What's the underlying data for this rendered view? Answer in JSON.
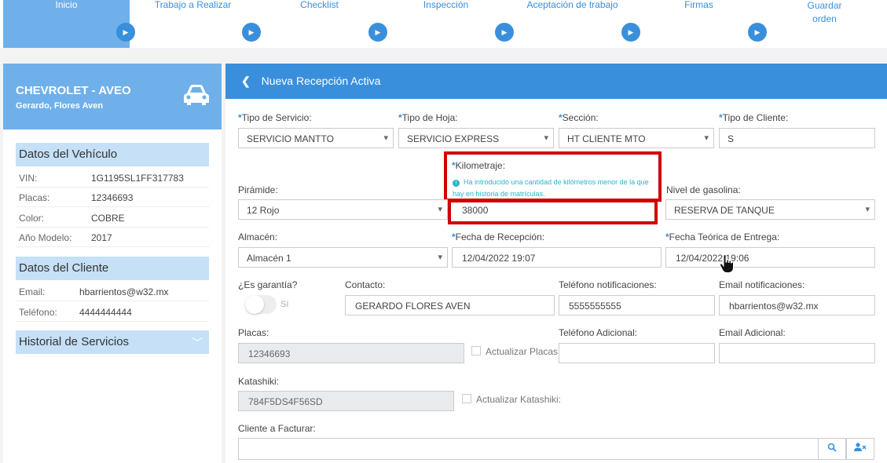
{
  "stepper": {
    "steps": [
      {
        "label": "Inicio"
      },
      {
        "label": "Trabajo a Realizar"
      },
      {
        "label": "Checklist"
      },
      {
        "label": "Inspección"
      },
      {
        "label": "Aceptación de trabajo"
      },
      {
        "label": "Firmas"
      },
      {
        "label": "Guardar\norden"
      }
    ]
  },
  "vehicle": {
    "title": "CHEVROLET - AVEO",
    "owner": "Gerardo, Flores Aven",
    "section_title": "Datos del Vehículo",
    "fields": [
      {
        "label": "VIN:",
        "value": "1G1195SL1FF317783"
      },
      {
        "label": "Placas:",
        "value": "12346693"
      },
      {
        "label": "Color:",
        "value": "COBRE"
      },
      {
        "label": "Año Modelo:",
        "value": "2017"
      }
    ]
  },
  "client": {
    "section_title": "Datos del Cliente",
    "fields": [
      {
        "label": "Email:",
        "value": "hbarrientos@w32.mx"
      },
      {
        "label": "Teléfono:",
        "value": "4444444444"
      }
    ]
  },
  "history": {
    "title": "Historial de Servicios"
  },
  "form": {
    "header": "Nueva Recepción Activa",
    "tipo_servicio": {
      "label": "Tipo de Servicio:",
      "value": "SERVICIO MANTTO"
    },
    "tipo_hoja": {
      "label": "Tipo de Hoja:",
      "value": "SERVICIO EXPRESS"
    },
    "seccion": {
      "label": "Sección:",
      "value": "HT CLIENTE MTO"
    },
    "tipo_cliente": {
      "label": "Tipo de Cliente:",
      "value": "S"
    },
    "kilometraje": {
      "label": "Kilometraje:",
      "value": "38000",
      "warning": "Ha introducido una cantidad de kilómetros menor de la que hay en historia de matrículas."
    },
    "piramide": {
      "label": "Pirámide:",
      "value": "12 Rojo"
    },
    "gasolina": {
      "label": "Nivel de gasolina:",
      "value": "RESERVA DE TANQUE"
    },
    "almacen": {
      "label": "Almacén:",
      "value": "Almacén 1"
    },
    "fecha_recepcion": {
      "label": "Fecha de Recepción:",
      "value": "12/04/2022 19:07"
    },
    "fecha_entrega": {
      "label": "Fecha Teórica de Entrega:",
      "value": "12/04/2022 19:06"
    },
    "garantia": {
      "label": "¿Es garantía?",
      "toggle_label": "Sí"
    },
    "contacto": {
      "label": "Contacto:",
      "value": "GERARDO FLORES AVEN"
    },
    "tel_notif": {
      "label": "Teléfono notificaciones:",
      "value": "5555555555"
    },
    "email_notif": {
      "label": "Email notificaciones:",
      "value": "hbarrientos@w32.mx"
    },
    "placas": {
      "label": "Placas:",
      "value": "12346693",
      "update_label": "Actualizar Placas:"
    },
    "tel_adicional": {
      "label": "Teléfono Adicional:",
      "value": ""
    },
    "email_adicional": {
      "label": "Email Adicional:",
      "value": ""
    },
    "katashiki": {
      "label": "Katashiki:",
      "value": "784F5DS4F56SD",
      "update_label": "Actualizar Katashiki:"
    },
    "cliente_facturar": {
      "label": "Cliente a Facturar:",
      "value": ""
    }
  },
  "colors": {
    "primary": "#3a8fdc",
    "light_blue": "#6fb0ea",
    "highlight": "#d00000",
    "warning": "#2bb5c9"
  }
}
